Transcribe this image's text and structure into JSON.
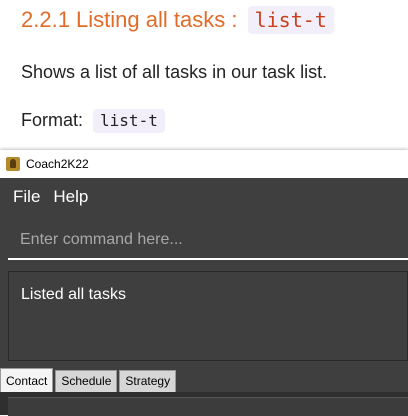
{
  "doc": {
    "heading": "2.2.1 Listing all tasks :",
    "heading_command": "list-t",
    "description": "Shows a list of all tasks in our task list.",
    "format_label": "Format:",
    "format_command": "list-t",
    "colors": {
      "heading": "#e06c2a",
      "code_background": "#f2effb"
    }
  },
  "window": {
    "title": "Coach2K22",
    "icon": "app-logo-icon"
  },
  "menu": {
    "items": [
      "File",
      "Help"
    ]
  },
  "command": {
    "placeholder": "Enter command here...",
    "value": ""
  },
  "result": {
    "message": "Listed all tasks"
  },
  "tabs": {
    "items": [
      "Contact",
      "Schedule",
      "Strategy"
    ],
    "active": "Contact"
  }
}
